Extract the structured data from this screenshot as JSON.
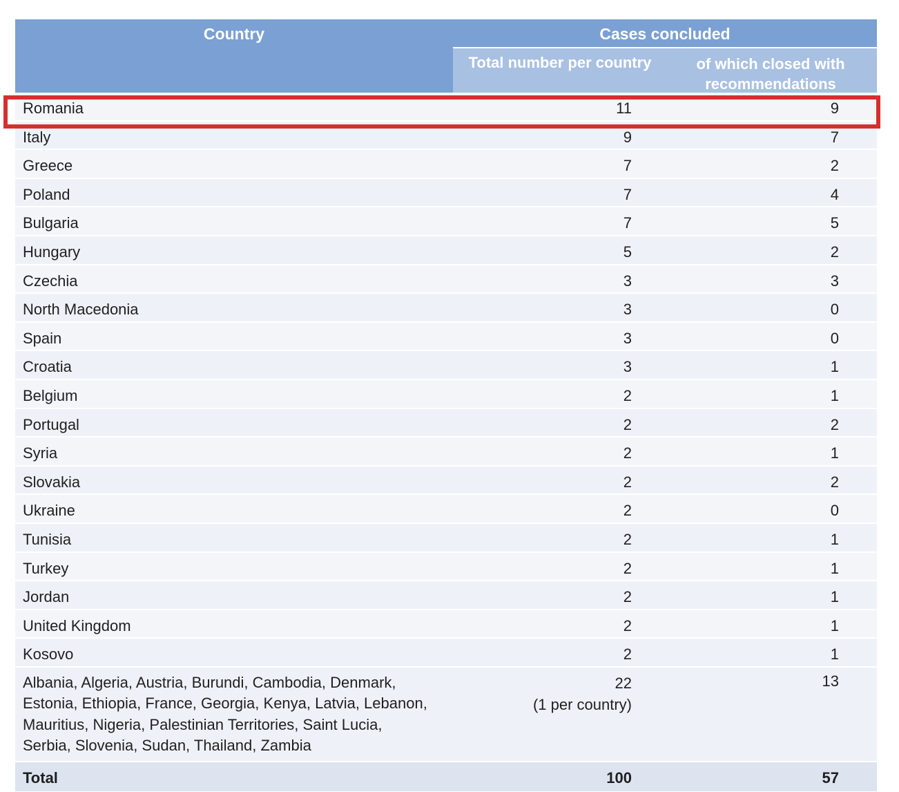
{
  "header": {
    "country": "Country",
    "cases_concluded": "Cases concluded",
    "total_per_country": "Total number per country",
    "closed_with_recommendations": "of which closed with recommendations"
  },
  "rows": [
    {
      "country": "Romania",
      "total": "11",
      "closed": "9"
    },
    {
      "country": "Italy",
      "total": "9",
      "closed": "7"
    },
    {
      "country": "Greece",
      "total": "7",
      "closed": "2"
    },
    {
      "country": "Poland",
      "total": "7",
      "closed": "4"
    },
    {
      "country": "Bulgaria",
      "total": "7",
      "closed": "5"
    },
    {
      "country": "Hungary",
      "total": "5",
      "closed": "2"
    },
    {
      "country": "Czechia",
      "total": "3",
      "closed": "3"
    },
    {
      "country": "North Macedonia",
      "total": "3",
      "closed": "0"
    },
    {
      "country": "Spain",
      "total": "3",
      "closed": "0"
    },
    {
      "country": "Croatia",
      "total": "3",
      "closed": "1"
    },
    {
      "country": "Belgium",
      "total": "2",
      "closed": "1"
    },
    {
      "country": "Portugal",
      "total": "2",
      "closed": "2"
    },
    {
      "country": "Syria",
      "total": "2",
      "closed": "1"
    },
    {
      "country": "Slovakia",
      "total": "2",
      "closed": "2"
    },
    {
      "country": "Ukraine",
      "total": "2",
      "closed": "0"
    },
    {
      "country": "Tunisia",
      "total": "2",
      "closed": "1"
    },
    {
      "country": "Turkey",
      "total": "2",
      "closed": "1"
    },
    {
      "country": "Jordan",
      "total": "2",
      "closed": "1"
    },
    {
      "country": "United Kingdom",
      "total": "2",
      "closed": "1"
    },
    {
      "country": "Kosovo",
      "total": "2",
      "closed": "1"
    }
  ],
  "others": {
    "countries_line1": "Albania, Algeria, Austria, Burundi, Cambodia, Denmark,",
    "countries_line2": "Estonia, Ethiopia, France, Georgia, Kenya, Latvia, Lebanon,",
    "countries_line3": "Mauritius, Nigeria, Palestinian Territories, Saint Lucia,",
    "countries_line4": "Serbia, Slovenia, Sudan, Thailand, Zambia",
    "total": "22",
    "total_note": "(1 per country)",
    "closed": "13"
  },
  "footer": {
    "label": "Total",
    "total": "100",
    "closed": "57"
  },
  "highlight": {
    "color": "#d62f2f",
    "row": "Romania"
  }
}
